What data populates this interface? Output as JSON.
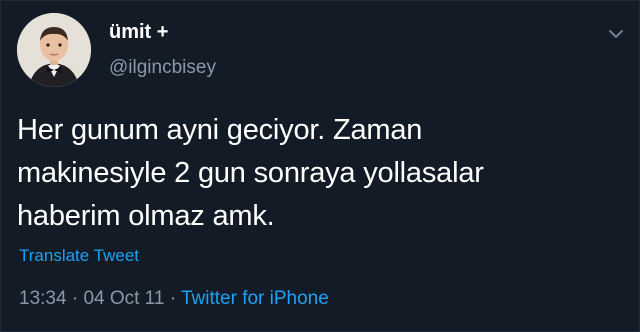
{
  "user": {
    "display_name": "ümit +",
    "handle": "@ilgincbisey"
  },
  "tweet": {
    "text_lines": [
      "Her gunum ayni geciyor. Zaman",
      "makinesiyle 2 gun sonraya yollasalar",
      "haberim olmaz amk."
    ],
    "translate_label": "Translate Tweet"
  },
  "meta": {
    "time": "13:34",
    "separator": "·",
    "date": "04 Oct 11",
    "source": "Twitter for iPhone"
  },
  "colors": {
    "background": "#131c26",
    "text": "#ffffff",
    "muted": "#8899a6",
    "link": "#1da1f2"
  },
  "icons": {
    "menu": "chevron-down-icon",
    "avatar": "avatar"
  }
}
